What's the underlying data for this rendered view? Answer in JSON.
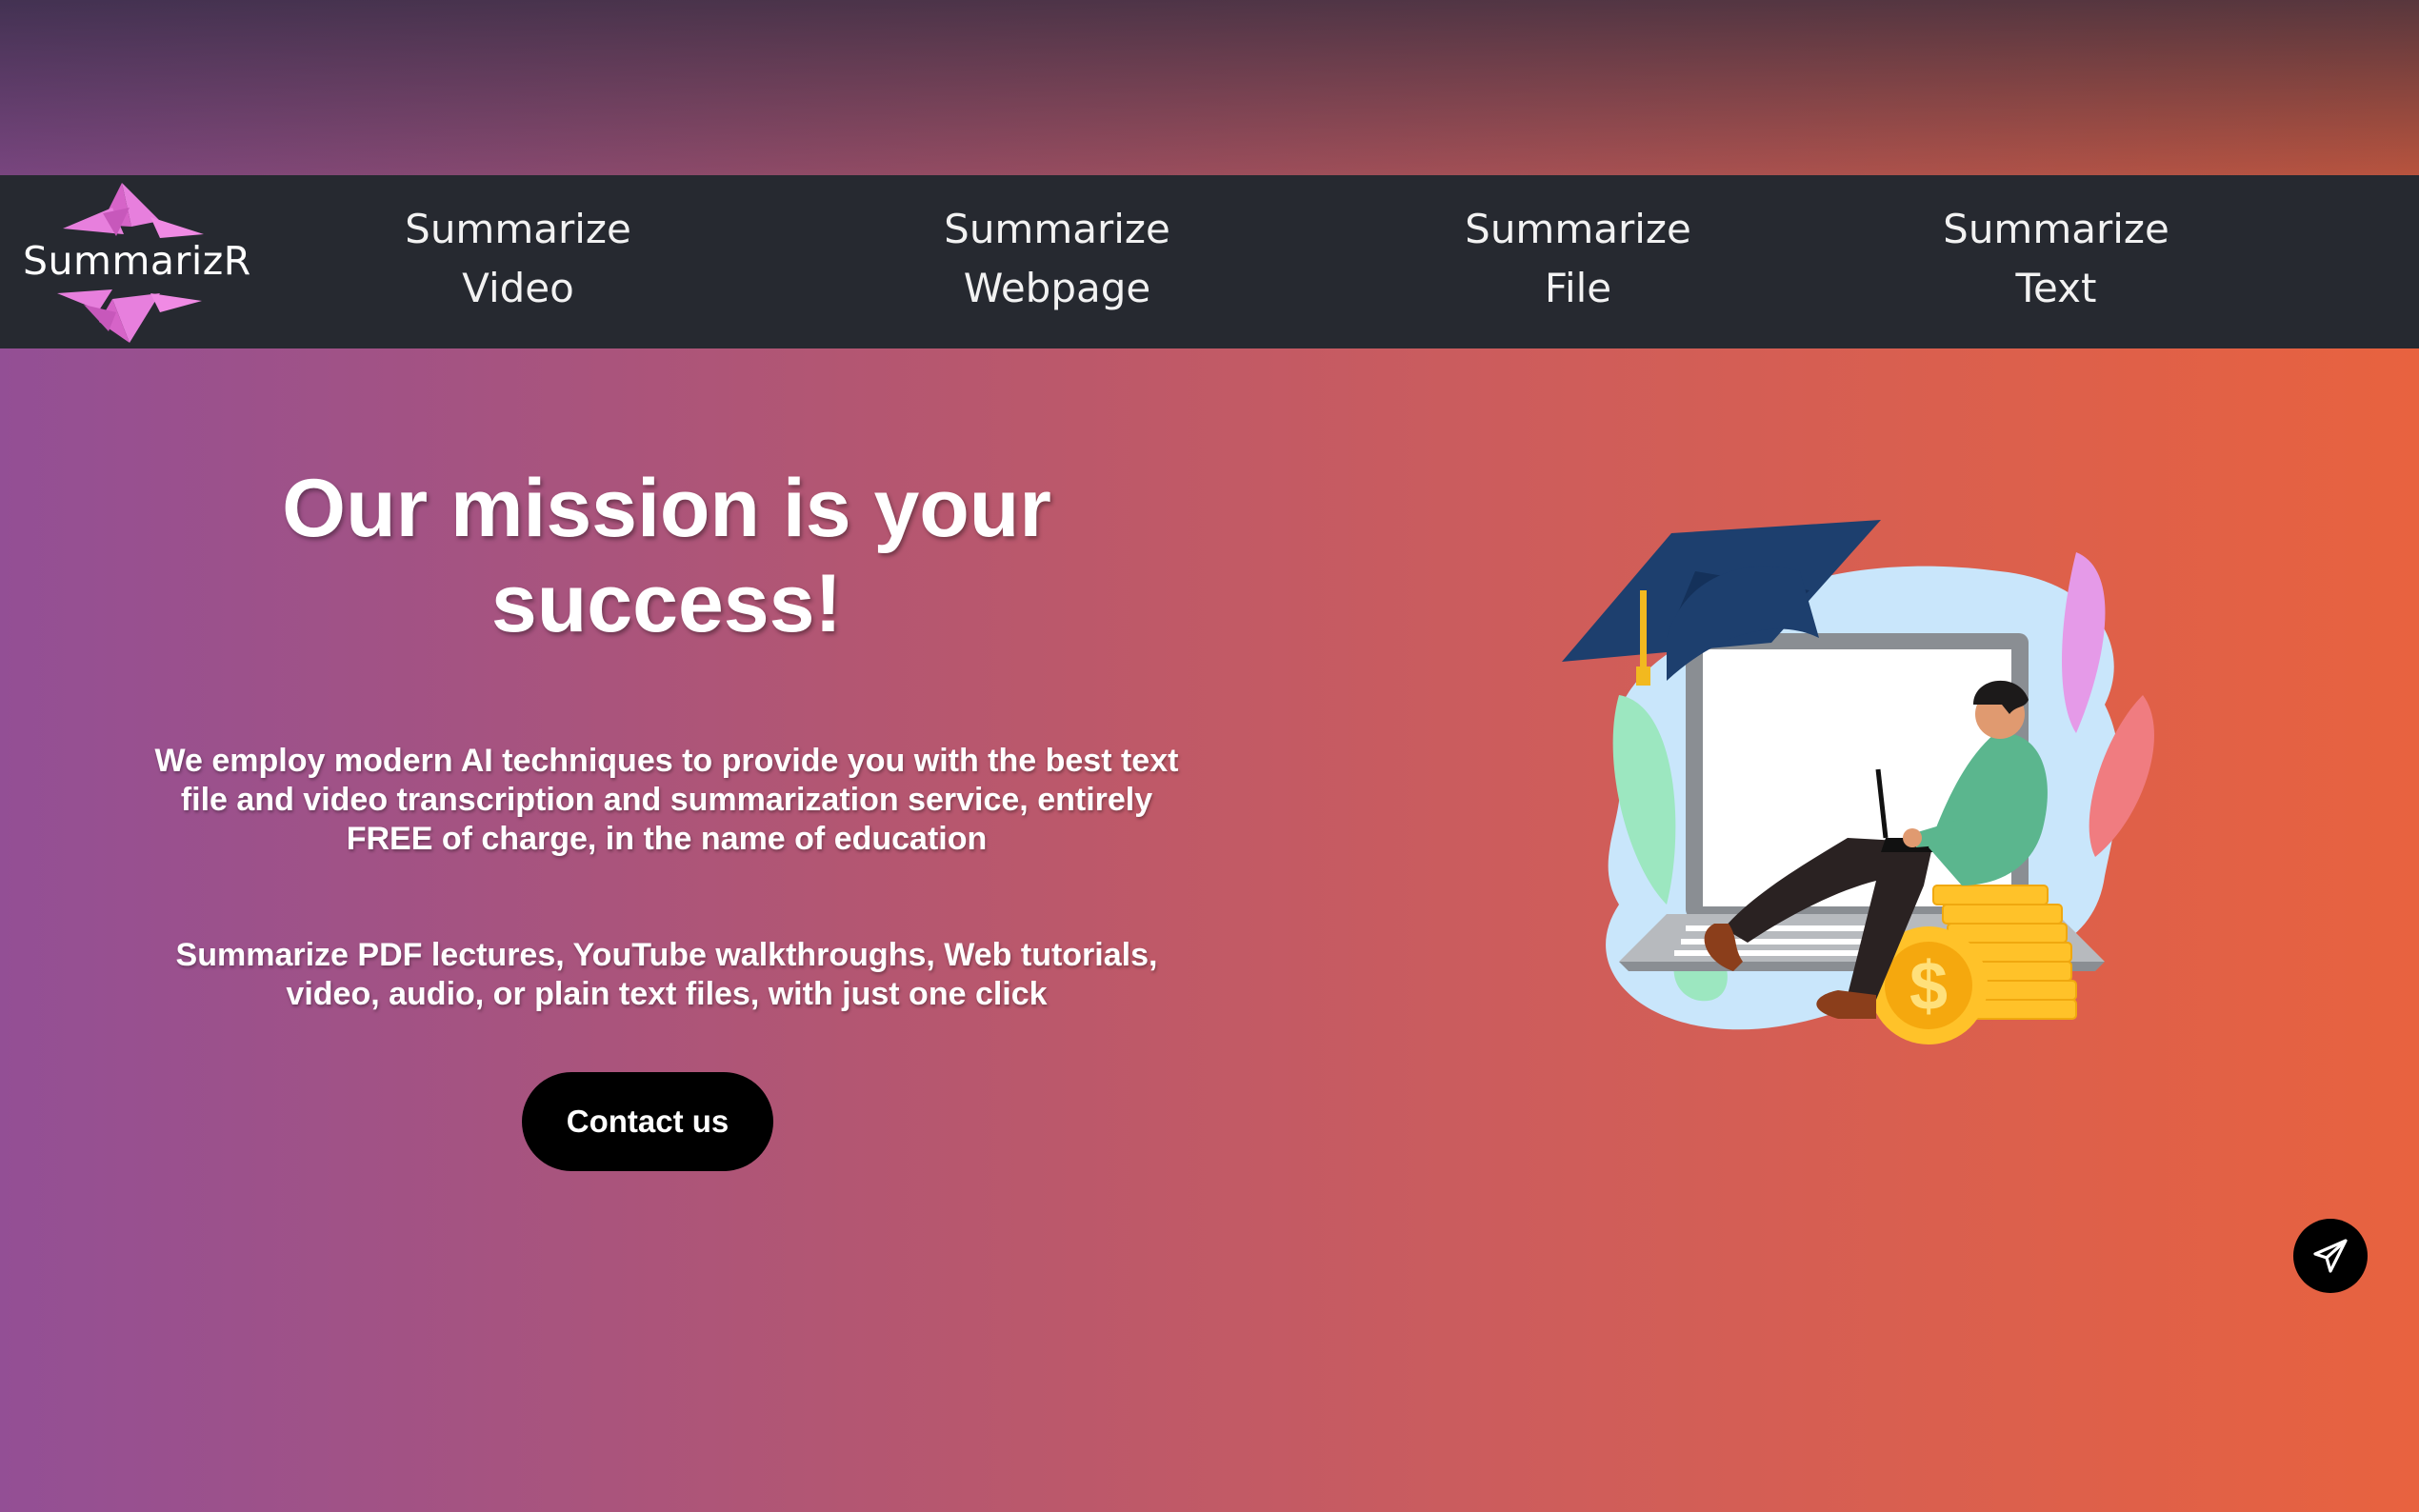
{
  "brand": {
    "name": "SummarizR",
    "logo_icon": "origami-star-logo",
    "accent_color": "#e77fdd"
  },
  "nav": {
    "items": [
      {
        "line1": "Summarize",
        "line2": "Video"
      },
      {
        "line1": "Summarize",
        "line2": "Webpage"
      },
      {
        "line1": "Summarize",
        "line2": "File"
      },
      {
        "line1": "Summarize",
        "line2": "Text"
      }
    ],
    "background_color": "#262930"
  },
  "hero": {
    "title_lines": [
      "Our mission is your",
      "success!"
    ],
    "paragraph1_lines": [
      "We employ modern AI techniques to provide you with the best text",
      "file and video transcription and summarization service, entirely",
      "FREE of charge, in the name of education"
    ],
    "paragraph2_lines": [
      "Summarize PDF lectures, YouTube walkthroughs, Web tutorials,",
      "video, audio, or plain text files, with just one click"
    ],
    "contact_button": "Contact us"
  },
  "illustration": {
    "icon": "graduate-laptop-coins-illustration"
  },
  "floating_action": {
    "icon": "send-plane-icon"
  },
  "colors": {
    "gradient_left": "#934f95",
    "gradient_right": "#e8623f",
    "button": "#000000"
  }
}
